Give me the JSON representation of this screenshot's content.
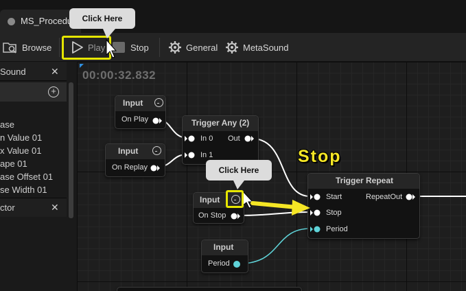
{
  "window": {
    "tab_title": "MS_Procedu"
  },
  "toolbar": {
    "browse": "Browse",
    "play": "Play",
    "stop": "Stop",
    "general": "General",
    "metasound": "MetaSound"
  },
  "left_panel": {
    "sound_tab": "Sound",
    "variables": [
      "ase",
      "n Value 01",
      "x Value 01",
      "ape 01",
      "ase Offset 01",
      "se Width 01"
    ],
    "detector_tab": "ctor"
  },
  "graph": {
    "timecode": "00:00:32.832",
    "nodes": {
      "input_play": {
        "title": "Input",
        "pin": "On Play"
      },
      "input_replay": {
        "title": "Input",
        "pin": "On Replay"
      },
      "trigger_any": {
        "title": "Trigger Any (2)",
        "in0": "In 0",
        "in1": "In 1",
        "out": "Out"
      },
      "input_stop": {
        "title": "Input",
        "pin": "On Stop"
      },
      "input_period": {
        "title": "Input",
        "pin": "Period"
      },
      "trigger_repeat": {
        "title": "Trigger Repeat",
        "start": "Start",
        "stop": "Stop",
        "period": "Period",
        "out": "RepeatOut"
      }
    }
  },
  "annotations": {
    "callout_top": "Click Here",
    "callout_graph": "Click Here",
    "stop_label": "Stop",
    "highlight_color": "#e6e600"
  },
  "colors": {
    "trigger_wire": "#ffffff",
    "float_wire": "#5fd3d8"
  }
}
